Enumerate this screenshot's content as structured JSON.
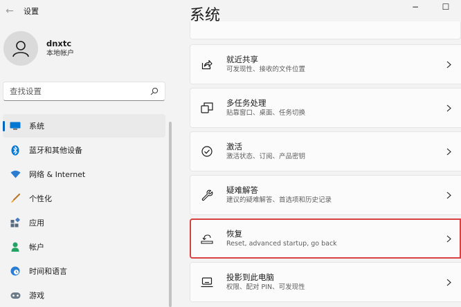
{
  "window": {
    "back_glyph": "←",
    "app_title": "设置",
    "minimize_glyph": "−",
    "maximize_glyph": "☐"
  },
  "profile": {
    "name": "dnxtc",
    "subtitle": "本地帐户"
  },
  "search": {
    "placeholder": "查找设置"
  },
  "sidebar": {
    "items": [
      {
        "label": "系统",
        "icon": "monitor-icon",
        "active": true
      },
      {
        "label": "蓝牙和其他设备",
        "icon": "bluetooth-icon"
      },
      {
        "label": "网络 & Internet",
        "icon": "wifi-icon"
      },
      {
        "label": "个性化",
        "icon": "brush-icon"
      },
      {
        "label": "应用",
        "icon": "apps-icon"
      },
      {
        "label": "帐户",
        "icon": "person-icon"
      },
      {
        "label": "时间和语言",
        "icon": "globe-clock-icon"
      },
      {
        "label": "游戏",
        "icon": "gamepad-icon"
      }
    ]
  },
  "main": {
    "title": "系统",
    "cards": [
      {
        "title": "就近共享",
        "subtitle": "可发现性、接收的文件位置",
        "icon": "share-icon"
      },
      {
        "title": "多任务处理",
        "subtitle": "贴靠窗口、桌面、任务切换",
        "icon": "multitask-icon"
      },
      {
        "title": "激活",
        "subtitle": "激活状态、订阅、产品密钥",
        "icon": "check-circle-icon"
      },
      {
        "title": "疑难解答",
        "subtitle": "建议的疑难解答、首选项和历史记录",
        "icon": "wrench-icon"
      },
      {
        "title": "恢复",
        "subtitle": "Reset, advanced startup, go back",
        "icon": "recovery-icon",
        "highlighted": true
      },
      {
        "title": "投影到此电脑",
        "subtitle": "权限、配对 PIN、可发现性",
        "icon": "projector-icon"
      }
    ]
  },
  "colors": {
    "accent": "#0067c0",
    "highlight_border": "#d9403f",
    "background": "#f3f3f3",
    "card": "#fbfbfb"
  }
}
